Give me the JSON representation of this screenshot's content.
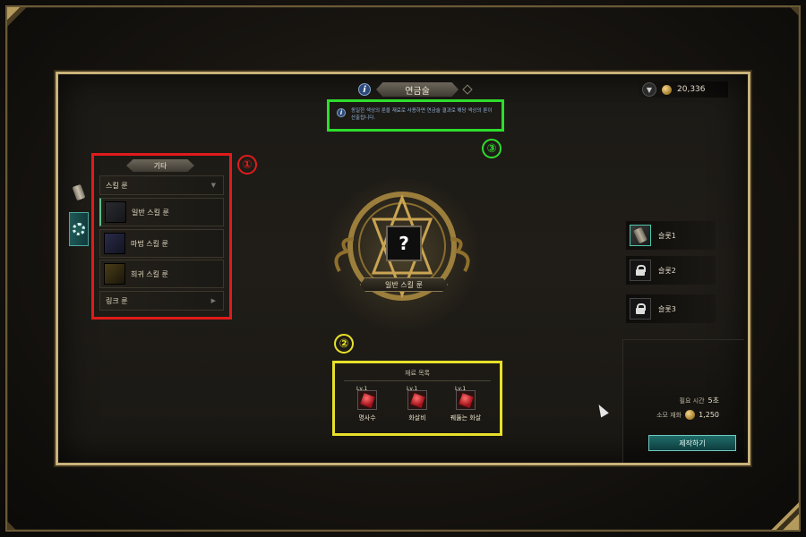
{
  "window": {
    "title": "연금술"
  },
  "currency": {
    "amount": "20,336",
    "icon": "coin-icon"
  },
  "notice": {
    "text": "동일한 색상의 룬을 재료로 사용하면 연금술 결과로 해당 색상의 룬이 산출됩니다."
  },
  "markers": [
    "①",
    "②",
    "③"
  ],
  "category_panel": {
    "header": "기타",
    "groups": [
      {
        "label": "스킬 룬",
        "caret": "▼"
      },
      {
        "label": "링크 룬",
        "caret": "▶"
      }
    ],
    "items": [
      {
        "label": "일반 스킬 룬"
      },
      {
        "label": "마법 스킬 룬"
      },
      {
        "label": "희귀 스킬 룬"
      }
    ]
  },
  "emblem": {
    "question_mark": "?",
    "label": "일반 스킬 룬"
  },
  "materials": {
    "title": "재료 목록",
    "items": [
      {
        "level": "Lv.1",
        "name": "명사수"
      },
      {
        "level": "Lv.1",
        "name": "화살비"
      },
      {
        "level": "Lv.1",
        "name": "꿰뚫는 화살"
      }
    ]
  },
  "slots": [
    {
      "label": "슬롯1",
      "state": "active"
    },
    {
      "label": "슬롯2",
      "state": "locked"
    },
    {
      "label": "슬롯3",
      "state": "locked"
    }
  ],
  "craft": {
    "time_label": "필요 시간",
    "time_value": "5초",
    "cost_label": "소모 재화",
    "cost_value": "1,250",
    "button_label": "제작하기"
  },
  "colors": {
    "box_category": "#e01b1b",
    "box_materials": "#e7e02a",
    "box_notice": "#2edc2e",
    "accent_teal": "#1f6c6a",
    "frame_gold": "#c9b27a"
  }
}
